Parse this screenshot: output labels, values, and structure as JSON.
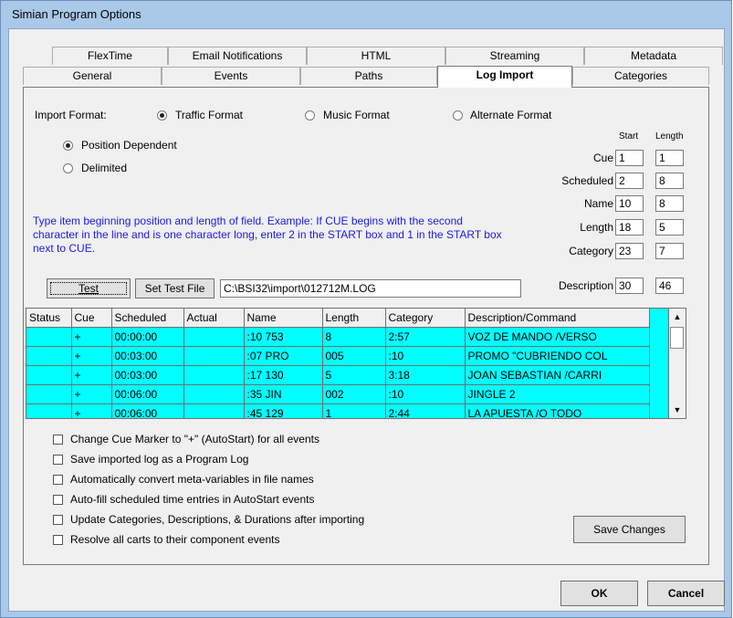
{
  "window": {
    "title": "Simian Program Options"
  },
  "tabs_row1": [
    "FlexTime",
    "Email Notifications",
    "HTML",
    "Streaming",
    "Metadata"
  ],
  "tabs_row2": [
    "General",
    "Events",
    "Paths",
    "Log Import",
    "Categories"
  ],
  "active_tab": "Log Import",
  "import_format": {
    "label": "Import Format:",
    "options": [
      "Traffic Format",
      "Music Format",
      "Alternate Format"
    ],
    "selected": "Traffic Format"
  },
  "parse_mode": {
    "options": [
      "Position Dependent",
      "Delimited"
    ],
    "selected": "Position Dependent"
  },
  "fields_header": {
    "start": "Start",
    "length": "Length"
  },
  "fields": [
    {
      "label": "Cue",
      "start": "1",
      "length": "1"
    },
    {
      "label": "Scheduled",
      "start": "2",
      "length": "8"
    },
    {
      "label": "Name",
      "start": "10",
      "length": "8"
    },
    {
      "label": "Length",
      "start": "18",
      "length": "5"
    },
    {
      "label": "Category",
      "start": "23",
      "length": "7"
    },
    {
      "label": "Description",
      "start": "30",
      "length": "46"
    }
  ],
  "help_text": "Type item beginning position and length of field. Example: If CUE begins with the second character in the line and is one character long, enter 2 in the START box and 1 in the START box next to CUE.",
  "test": {
    "test_button": "Test",
    "set_test_file_button": "Set Test File",
    "file_path": "C:\\BSI32\\import\\012712M.LOG"
  },
  "grid": {
    "columns": [
      "Status",
      "Cue",
      "Scheduled",
      "Actual",
      "Name",
      "Length",
      "Category",
      "Description/Command"
    ],
    "rows": [
      [
        "",
        "+",
        "00:00:00",
        "",
        ":10  753",
        "8",
        "2:57",
        "VOZ DE MANDO        /VERSO"
      ],
      [
        "",
        "+",
        "00:03:00",
        "",
        ":07  PRO",
        "005",
        ":10",
        "PROMO \"CUBRIENDO COL"
      ],
      [
        "",
        "+",
        "00:03:00",
        "",
        ":17  130",
        "5",
        "3:18",
        "JOAN SEBASTIAN       /CARRI"
      ],
      [
        "",
        "+",
        "00:06:00",
        "",
        ":35  JIN",
        "002",
        ":10",
        "JINGLE 2"
      ],
      [
        "",
        "+",
        "00:06:00",
        "",
        ":45  129",
        "1",
        "2:44",
        "LA APUESTA          /O TODO"
      ]
    ],
    "row_color": "#00ffff"
  },
  "options": [
    {
      "label": "Change Cue Marker to \"+\" (AutoStart) for all events",
      "checked": false
    },
    {
      "label": "Save imported log as a Program Log",
      "checked": false
    },
    {
      "label": "Automatically convert meta-variables in file names",
      "checked": false
    },
    {
      "label": "Auto-fill scheduled time entries in AutoStart events",
      "checked": false
    },
    {
      "label": "Update Categories, Descriptions, & Durations after importing",
      "checked": false
    },
    {
      "label": "Resolve all carts to their component events",
      "checked": false
    }
  ],
  "buttons": {
    "save_changes": "Save Changes",
    "ok": "OK",
    "cancel": "Cancel"
  }
}
